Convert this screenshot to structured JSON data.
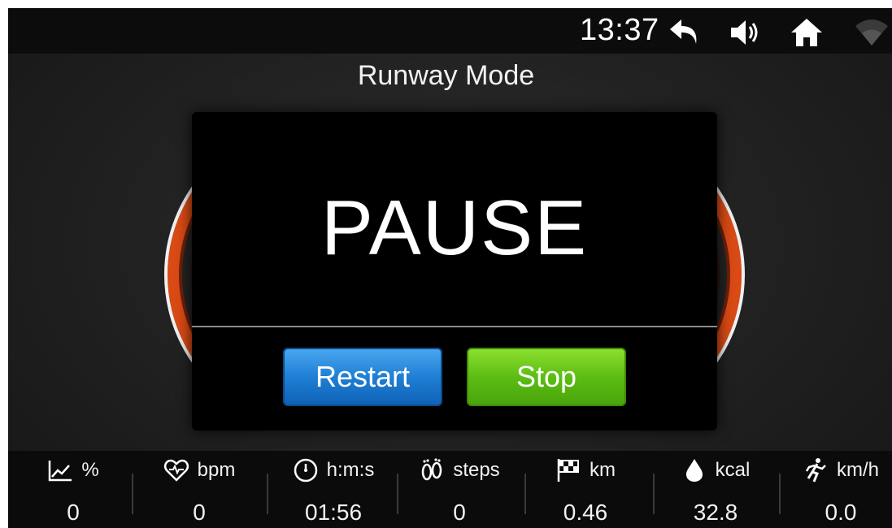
{
  "status_bar": {
    "time": "13:37",
    "icons": [
      "back-arrow-icon",
      "volume-icon",
      "home-icon",
      "wifi-icon"
    ]
  },
  "title": "Runway Mode",
  "dialog": {
    "heading": "PAUSE",
    "restart_label": "Restart",
    "stop_label": "Stop"
  },
  "stats": [
    {
      "icon": "incline-chart-icon",
      "unit": "%",
      "value": "0"
    },
    {
      "icon": "heart-rate-icon",
      "unit": "bpm",
      "value": "0"
    },
    {
      "icon": "stopwatch-icon",
      "unit": "h:m:s",
      "value": "01:56"
    },
    {
      "icon": "footprints-icon",
      "unit": "steps",
      "value": "0"
    },
    {
      "icon": "checkered-flag-icon",
      "unit": "km",
      "value": "0.46"
    },
    {
      "icon": "calorie-drop-icon",
      "unit": "kcal",
      "value": "32.8"
    },
    {
      "icon": "runner-icon",
      "unit": "km/h",
      "value": "0.0"
    }
  ],
  "colors": {
    "restart_button": "#1f7fd4",
    "stop_button": "#5cbd13",
    "track_accent": "#d94a15"
  }
}
